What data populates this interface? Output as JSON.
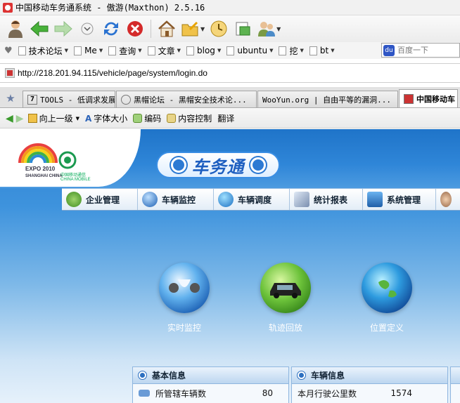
{
  "window": {
    "title": "中国移动车务通系统 - 傲游(Maxthon) 2.5.16"
  },
  "favorites": {
    "items": [
      "技术论坛",
      "Me",
      "查询",
      "文章",
      "blog",
      "ubuntu",
      "挖",
      "bt"
    ],
    "search_placeholder": "百度一下"
  },
  "address": {
    "url": "http://218.201.94.115/vehicle/page/system/login.do"
  },
  "tabs": [
    {
      "label": "TOOLS - 低调求发展",
      "icon": "7"
    },
    {
      "label": "黑帽论坛 - 黑帽安全技术论...",
      "icon": ""
    },
    {
      "label": "WooYun.org | 自由平等的漏洞...",
      "icon": ""
    },
    {
      "label": "中国移动车",
      "icon": "",
      "active": true
    }
  ],
  "subtoolbar": {
    "up": "向上一级",
    "font_size": "字体大小",
    "encoding": "编码",
    "content_control": "内容控制",
    "translate": "翻译"
  },
  "site": {
    "brand": "车务通",
    "expo": "EXPO 2010",
    "expo_sub": "SHANGHAI CHINA",
    "cm_name": "中国移动通信",
    "cm_en": "CHINA MOBILE",
    "nav": [
      "企业管理",
      "车辆监控",
      "车辆调度",
      "统计报表",
      "系统管理"
    ],
    "features": [
      "实时监控",
      "轨迹回放",
      "位置定义"
    ],
    "panels": [
      {
        "title": "基本信息",
        "row_label": "所管辖车辆数",
        "row_value": "80"
      },
      {
        "title": "车辆信息",
        "row_label": "本月行驶公里数",
        "row_value": "1574"
      }
    ]
  },
  "colors": {
    "accent": "#2c7fd2",
    "brand_blue": "#1e5fc0"
  }
}
